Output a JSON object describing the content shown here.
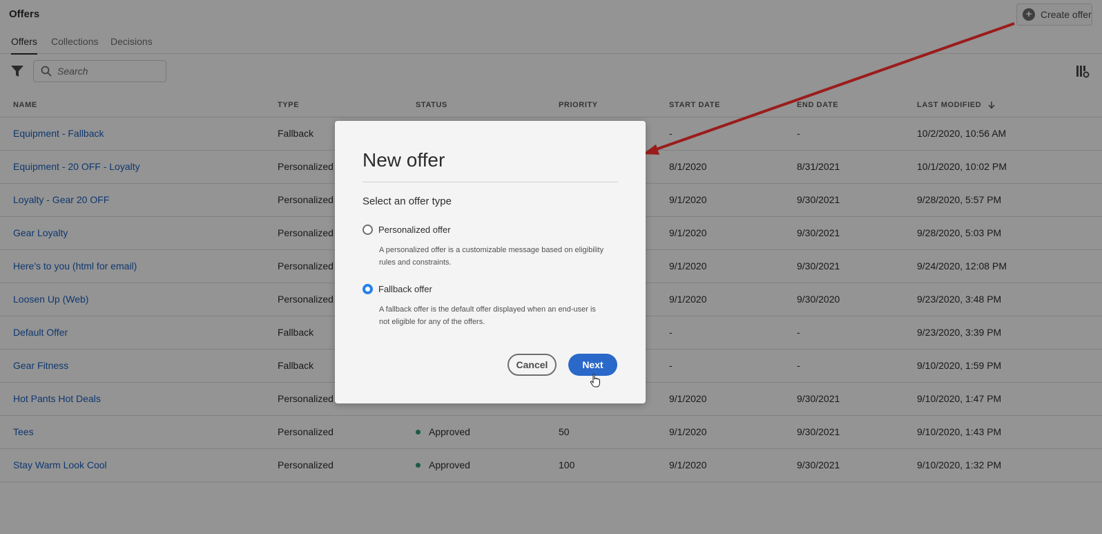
{
  "page": {
    "title": "Offers",
    "create_label": "Create offer",
    "tabs": [
      "Offers",
      "Collections",
      "Decisions"
    ],
    "search_placeholder": "Search"
  },
  "table": {
    "headers": {
      "name": "NAME",
      "type": "TYPE",
      "status": "STATUS",
      "priority": "PRIORITY",
      "start": "START DATE",
      "end": "END DATE",
      "modified": "LAST MODIFIED"
    },
    "rows": [
      {
        "name": "Equipment - Fallback",
        "type": "Fallback",
        "status": "",
        "priority": "",
        "start": "-",
        "end": "-",
        "modified": "10/2/2020, 10:56 AM"
      },
      {
        "name": "Equipment - 20 OFF - Loyalty",
        "type": "Personalized",
        "status": "",
        "priority": "",
        "start": "8/1/2020",
        "end": "8/31/2021",
        "modified": "10/1/2020, 10:02 PM"
      },
      {
        "name": "Loyalty - Gear 20 OFF",
        "type": "Personalized",
        "status": "",
        "priority": "",
        "start": "9/1/2020",
        "end": "9/30/2021",
        "modified": "9/28/2020, 5:57 PM"
      },
      {
        "name": "Gear Loyalty",
        "type": "Personalized",
        "status": "",
        "priority": "",
        "start": "9/1/2020",
        "end": "9/30/2021",
        "modified": "9/28/2020, 5:03 PM"
      },
      {
        "name": "Here's to you (html for email)",
        "type": "Personalized",
        "status": "",
        "priority": "",
        "start": "9/1/2020",
        "end": "9/30/2021",
        "modified": "9/24/2020, 12:08 PM"
      },
      {
        "name": "Loosen Up (Web)",
        "type": "Personalized",
        "status": "",
        "priority": "",
        "start": "9/1/2020",
        "end": "9/30/2020",
        "modified": "9/23/2020, 3:48 PM"
      },
      {
        "name": "Default Offer",
        "type": "Fallback",
        "status": "",
        "priority": "",
        "start": "-",
        "end": "-",
        "modified": "9/23/2020, 3:39 PM"
      },
      {
        "name": "Gear Fitness",
        "type": "Fallback",
        "status": "",
        "priority": "",
        "start": "-",
        "end": "-",
        "modified": "9/10/2020, 1:59 PM"
      },
      {
        "name": "Hot Pants Hot Deals",
        "type": "Personalized",
        "status": "",
        "priority": "",
        "start": "9/1/2020",
        "end": "9/30/2021",
        "modified": "9/10/2020, 1:47 PM"
      },
      {
        "name": "Tees",
        "type": "Personalized",
        "status": "Approved",
        "priority": "50",
        "start": "9/1/2020",
        "end": "9/30/2021",
        "modified": "9/10/2020, 1:43 PM"
      },
      {
        "name": "Stay Warm Look Cool",
        "type": "Personalized",
        "status": "Approved",
        "priority": "100",
        "start": "9/1/2020",
        "end": "9/30/2021",
        "modified": "9/10/2020, 1:32 PM"
      }
    ]
  },
  "modal": {
    "title": "New offer",
    "subtitle": "Select an offer type",
    "options": [
      {
        "label": "Personalized offer",
        "checked": false,
        "desc_line1": "A personalized offer is a customizable message based on eligibility",
        "desc_line2": "rules and constraints."
      },
      {
        "label": "Fallback offer",
        "checked": true,
        "desc_line1": "A fallback offer is the default offer displayed when an end-user is",
        "desc_line2": "not eligible for any of the offers."
      }
    ],
    "cancel_label": "Cancel",
    "next_label": "Next"
  },
  "colors": {
    "link": "#1b5fbf",
    "accent": "#2a68c9",
    "approved": "#2d9d78",
    "annotation_arrow": "#9b1c1c"
  },
  "icons": [
    "plus-circle-icon",
    "filter-icon",
    "search-icon",
    "column-settings-icon",
    "sort-down-arrow-icon",
    "hand-cursor-icon"
  ]
}
